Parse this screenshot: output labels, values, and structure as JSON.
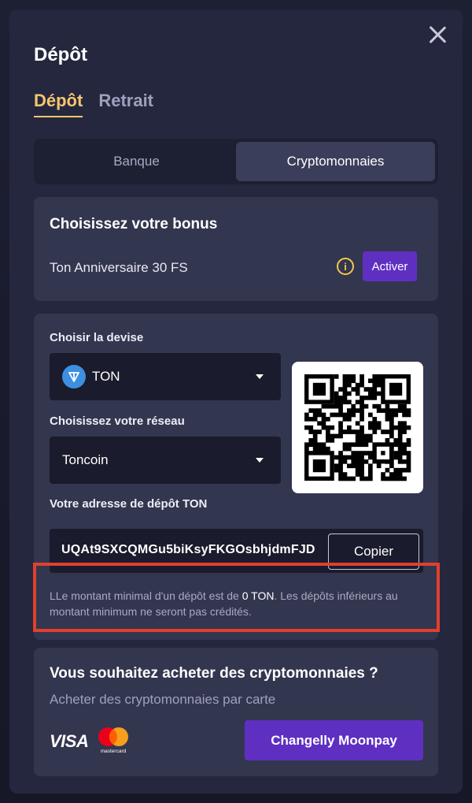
{
  "modal": {
    "title": "Dépôt",
    "tabs": [
      {
        "label": "Dépôt",
        "active": true
      },
      {
        "label": "Retrait",
        "active": false
      }
    ],
    "methods": [
      {
        "label": "Banque",
        "active": false
      },
      {
        "label": "Cryptomonnaies",
        "active": true
      }
    ]
  },
  "bonus": {
    "title": "Choisissez votre bonus",
    "name": "Ton Anniversaire 30 FS",
    "info_icon": "i",
    "activate_label": "Activer"
  },
  "deposit": {
    "currency_label": "Choisir la devise",
    "currency_value": "TON",
    "network_label": "Choisissez votre réseau",
    "network_value": "Toncoin",
    "address_label": "Votre adresse de dépôt TON",
    "address_value": "UQAt9SXCQMGu5biKsyFKGOsbhjdmFJD",
    "copy_label": "Copier",
    "notice_pre": "LLe montant minimal d'un dépôt est de ",
    "notice_amount": "0 TON",
    "notice_post": ". Les dépôts inférieurs au montant minimum ne seront pas crédités."
  },
  "buy": {
    "title": "Vous souhaitez acheter des cryptomonnaies ?",
    "subtitle": "Acheter des cryptomonnaies par carte",
    "visa_label": "VISA",
    "mastercard_label": "mastercard",
    "button_label": "Changelly Moonpay"
  },
  "colors": {
    "accent": "#f6c66e",
    "primary_button": "#5f2fc2",
    "modal_bg": "#25273f",
    "card_bg": "#33364f",
    "highlight": "#e0402d"
  }
}
